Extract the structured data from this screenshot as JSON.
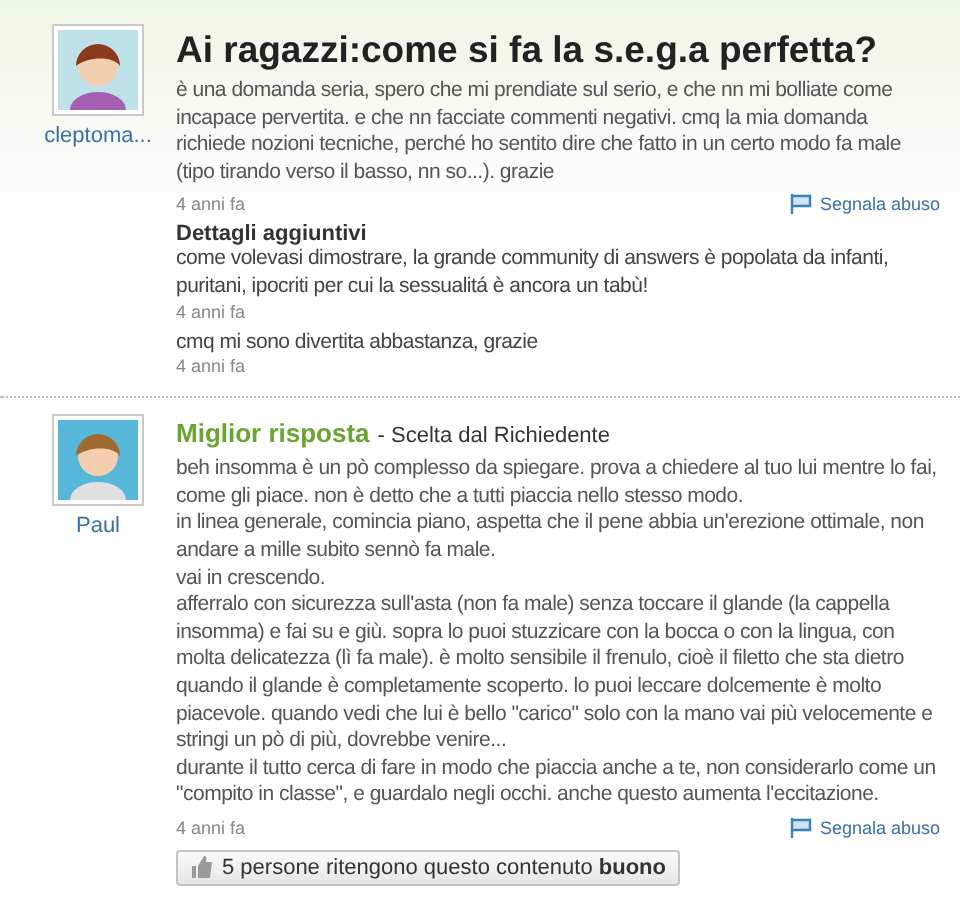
{
  "question": {
    "author": "cleptoma...",
    "title": "Ai ragazzi:come si fa la s.e.g.a perfetta?",
    "body": "è una domanda seria, spero che mi prendiate sul serio, e che nn mi bolliate come incapace pervertita. e che nn facciate commenti negativi. cmq la mia domanda richiede nozioni tecniche, perché ho sentito dire che fatto in un certo modo fa male (tipo tirando verso il basso, nn so...). grazie",
    "time": "4 anni fa",
    "report": "Segnala abuso"
  },
  "details": {
    "heading": "Dettagli aggiuntivi",
    "entries": [
      {
        "text": "come volevasi dimostrare, la grande community di answers è popolata da infanti, puritani, ipocriti per cui la sessualitá è ancora un tabù!",
        "time": "4 anni fa"
      },
      {
        "text": "cmq mi sono divertita abbastanza, grazie",
        "time": "4 anni fa"
      }
    ]
  },
  "best_answer": {
    "author": "Paul",
    "label": "Miglior risposta",
    "chosen_by": "- Scelta dal Richiedente",
    "paragraphs": [
      "beh insomma è un pò complesso da spiegare. prova a chiedere al tuo lui mentre lo fai, come gli piace. non è detto che a tutti piaccia nello stesso modo.",
      "in linea generale, comincia piano, aspetta che il pene abbia un'erezione ottimale, non andare a mille subito sennò fa male.",
      "vai in crescendo.",
      "afferralo con sicurezza sull'asta (non fa male) senza toccare il glande (la cappella insomma) e fai su e giù. sopra lo puoi stuzzicare con la bocca o con la lingua, con molta delicatezza (lì fa male). è molto sensibile il frenulo, cioè il filetto che sta dietro quando il glande è completamente scoperto. lo puoi leccare dolcemente è molto piacevole. quando vedi che lui è bello \"carico\" solo con la mano vai più velocemente e stringi un pò di più, dovrebbe venire...",
      "durante il tutto cerca di fare in modo che piaccia anche a te, non considerarlo come un \"compito in classe\", e guardalo negli occhi. anche questo aumenta l'eccitazione."
    ],
    "time": "4 anni fa",
    "report": "Segnala abuso",
    "rating_button": "5 persone ritengono questo contenuto **buono**"
  }
}
